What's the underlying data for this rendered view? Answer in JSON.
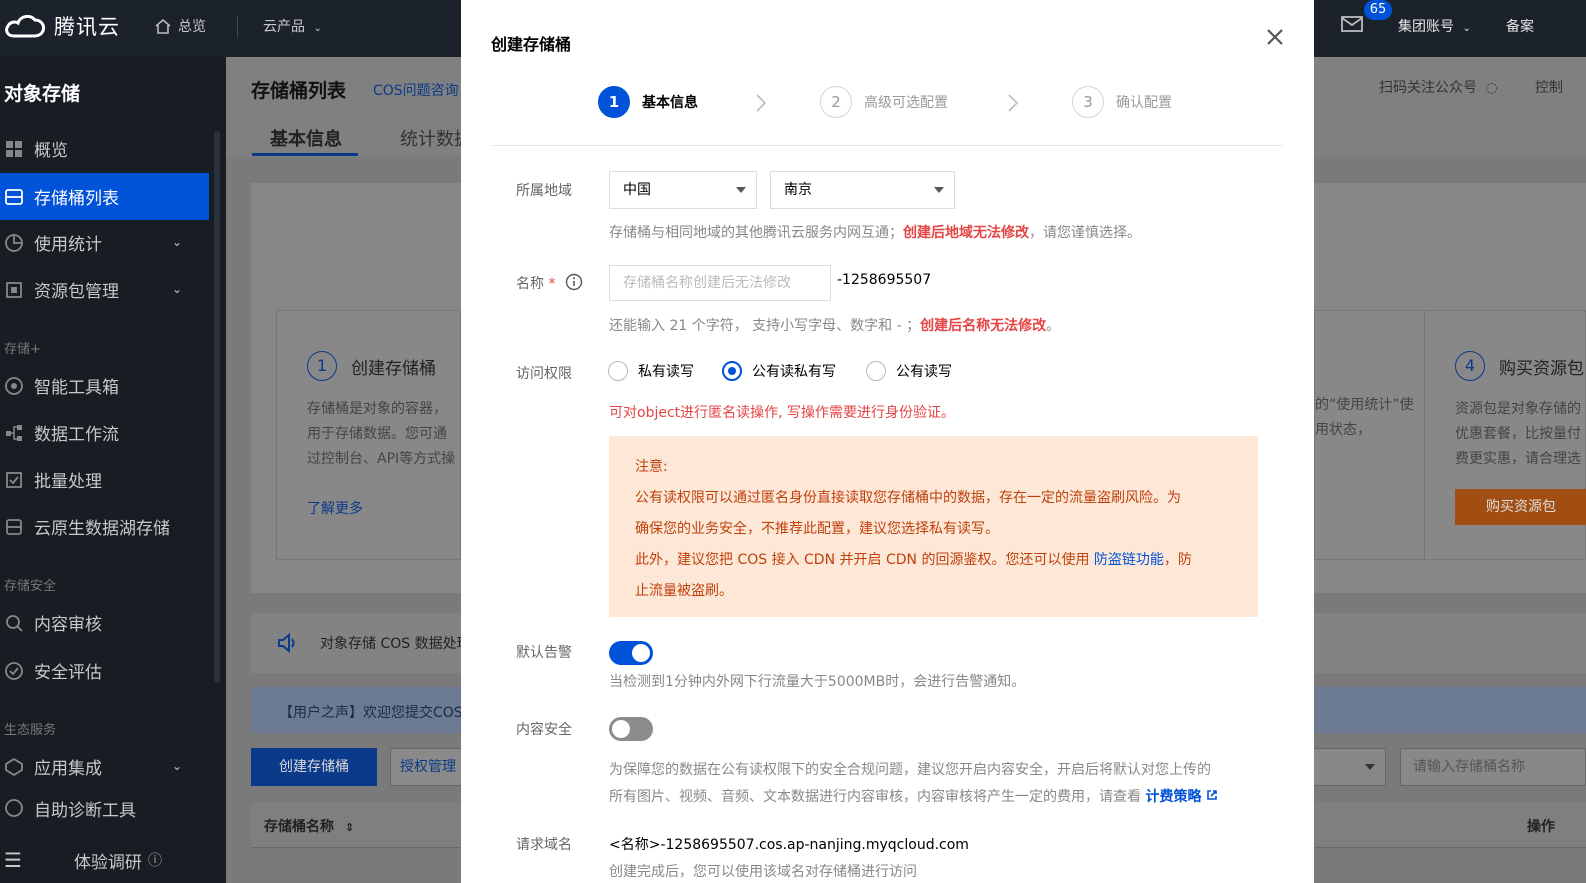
{
  "topbar": {
    "logo_text": "腾讯云",
    "home": "总览",
    "products": "云产品",
    "mail_count": "65",
    "account": "集团账号",
    "beian": "备案"
  },
  "sidebar": {
    "title": "对象存储",
    "items": [
      {
        "label": "概览"
      },
      {
        "label": "存储桶列表"
      },
      {
        "label": "使用统计"
      },
      {
        "label": "资源包管理"
      },
      {
        "label": "智能工具箱"
      },
      {
        "label": "数据工作流"
      },
      {
        "label": "批量处理"
      },
      {
        "label": "云原生数据湖存储"
      },
      {
        "label": "内容审核"
      },
      {
        "label": "安全评估"
      },
      {
        "label": "应用集成"
      },
      {
        "label": "自助诊断工具"
      }
    ],
    "groups": {
      "storage_plus": "存储+",
      "storage_security": "存储安全",
      "ecosystem": "生态服务"
    },
    "bottom_label": "体验调研"
  },
  "main": {
    "title": "存储桶列表",
    "title_link": "COS问题咨询",
    "qr_text": "扫码关注公众号",
    "console_text": "控制",
    "tabs": [
      "基本信息",
      "统计数据"
    ],
    "step1_num": "1",
    "step1_title": "创建存储桶",
    "step1_desc": "存储桶是对象的容器，用于存储数据。您可通过控制台、API等方式操作。",
    "learn_more": "了解更多",
    "step4_num": "4",
    "step4_title": "购买资源包",
    "step4_desc": "资源包是对象存储的优惠套餐，比按量付费更实惠，请合理选购。",
    "step3_desc": "的“使用统计”使用状态，",
    "buy_button": "购买资源包",
    "notice": "对象存储 COS 数据处理",
    "user_voice": "【用户之声】欢迎您提交COS",
    "create_button": "创建存储桶",
    "auth_button": "授权管理",
    "search_placeholder": "请输入存储桶名称",
    "th_name": "存储桶名称",
    "th_op": "操作"
  },
  "modal": {
    "title": "创建存储桶",
    "steps": [
      {
        "num": "1",
        "label": "基本信息"
      },
      {
        "num": "2",
        "label": "高级可选配置"
      },
      {
        "num": "3",
        "label": "确认配置"
      }
    ],
    "region": {
      "label": "所属地域",
      "country": "中国",
      "city": "南京",
      "hint_prefix": "存储桶与相同地域的其他腾讯云服务内网互通；",
      "hint_red": "创建后地域无法修改",
      "hint_suffix": "，请您谨慎选择。"
    },
    "name": {
      "label": "名称",
      "star": "*",
      "placeholder": "存储桶名称创建后无法修改",
      "suffix": "-1258695507",
      "hint_prefix": "还能输入 21 个字符， 支持小写字母、数字和 - ；",
      "hint_red": "创建后名称无法修改",
      "hint_suffix": "。"
    },
    "access": {
      "label": "访问权限",
      "options": [
        "私有读写",
        "公有读私有写",
        "公有读写"
      ],
      "selected": "公有读私有写",
      "red_hint": "可对object进行匿名读操作, 写操作需要进行身份验证。"
    },
    "warning": {
      "title": "注意:",
      "line1": "公有读权限可以通过匿名身份直接读取您存储桶中的数据，存在一定的流量盗刷风险。为",
      "line2": "确保您的业务安全，不推荐此配置，建议您选择私有读写。",
      "line3_prefix": "此外，建议您把 COS 接入 CDN 并开启 CDN 的回源鉴权。您还可以使用 ",
      "line3_link": "防盗链功能",
      "line3_suffix": "，防",
      "line4": "止流量被盗刷。"
    },
    "alarm": {
      "label": "默认告警",
      "enabled": true,
      "hint": "当检测到1分钟内外网下行流量大于5000MB时，会进行告警通知。"
    },
    "content_security": {
      "label": "内容安全",
      "enabled": false,
      "hint_line1": "为保障您的数据在公有读权限下的安全合规问题，建议您开启内容安全，开启后将默认对您上传的",
      "hint_line2": "所有图片、视频、音频、文本数据进行内容审核，内容审核将产生一定的费用，请查看 ",
      "link": "计费策略"
    },
    "domain": {
      "label": "请求域名",
      "value": "<名称>-1258695507.cos.ap-nanjing.myqcloud.com",
      "hint": "创建完成后，您可以使用该域名对存储桶进行访问"
    }
  }
}
